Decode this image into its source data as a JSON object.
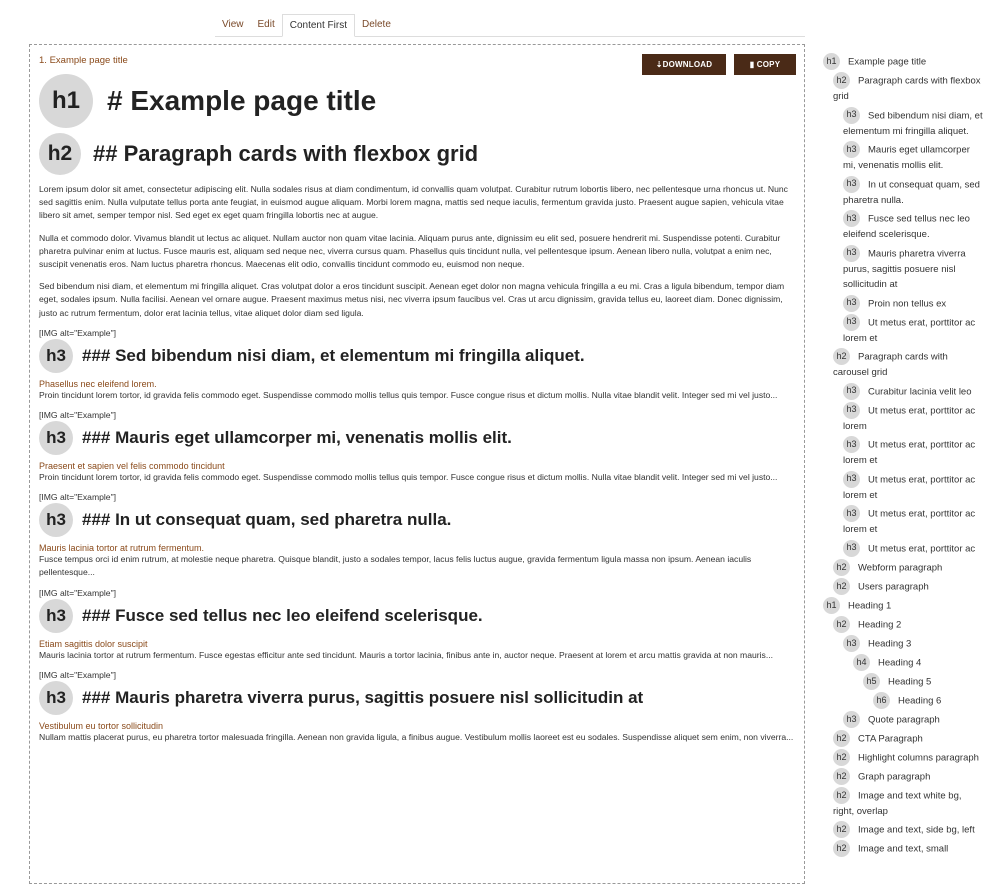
{
  "tabs": [
    "View",
    "Edit",
    "Content First",
    "Delete"
  ],
  "main": {
    "breadcrumb_num": "1.",
    "breadcrumb_text": "Example page title",
    "download_label": "⇣DOWNLOAD",
    "copy_label": "▮ COPY",
    "h1": {
      "badge": "h1",
      "text": "# Example page title"
    },
    "h2": {
      "badge": "h2",
      "text": "## Paragraph cards with flexbox grid"
    },
    "paras": [
      "Lorem ipsum dolor sit amet, consectetur adipiscing elit. Nulla sodales risus at diam condimentum, id convallis quam volutpat. Curabitur rutrum lobortis libero, nec pellentesque urna rhoncus ut. Nunc sed sagittis enim. Nulla vulputate tellus porta ante feugiat, in euismod augue aliquam. Morbi lorem magna, mattis sed neque iaculis, fermentum gravida justo. Praesent augue sapien, vehicula vitae libero sit amet, semper tempor nisl. Sed eget ex eget quam fringilla lobortis nec at augue.",
      "Nulla et commodo dolor. Vivamus blandit ut lectus ac aliquet. Nullam auctor non quam vitae lacinia. Aliquam purus ante, dignissim eu elit sed, posuere hendrerit mi. Suspendisse potenti. Curabitur pharetra pulvinar enim at luctus. Fusce mauris est, aliquam sed neque nec, viverra cursus quam. Phasellus quis tincidunt nulla, vel pellentesque ipsum. Aenean libero nulla, volutpat a enim nec, suscipit venenatis eros. Nam luctus pharetra rhoncus. Maecenas elit odio, convallis tincidunt commodo eu, euismod non neque.",
      "Sed bibendum nisi diam, et elementum mi fringilla aliquet. Cras volutpat dolor a eros tincidunt suscipit. Aenean eget dolor non magna vehicula fringilla a eu mi. Cras a ligula bibendum, tempor diam eget, sodales ipsum. Nulla facilisi. Aenean vel ornare augue. Praesent maximus metus nisi, nec viverra ipsum faucibus vel. Cras ut arcu dignissim, gravida tellus eu, laoreet diam. Donec dignissim, justo ac rutrum fermentum, dolor erat lacinia tellus, vitae aliquet dolor diam sed ligula."
    ],
    "img_label": "[IMG alt=\"Example\"]",
    "sections": [
      {
        "badge": "h3",
        "title": "### Sed bibendum nisi diam, et elementum mi fringilla aliquet.",
        "sub": "Phasellus nec eleifend lorem.",
        "text": "Proin tincidunt lorem tortor, id gravida felis commodo eget. Suspendisse commodo mollis tellus quis tempor. Fusce congue risus et dictum mollis. Nulla vitae blandit velit. Integer sed mi vel justo..."
      },
      {
        "badge": "h3",
        "title": "### Mauris eget ullamcorper mi, venenatis mollis elit.",
        "sub": "Praesent et sapien vel felis commodo tincidunt",
        "text": "Proin tincidunt lorem tortor, id gravida felis commodo eget. Suspendisse commodo mollis tellus quis tempor. Fusce congue risus et dictum mollis. Nulla vitae blandit velit. Integer sed mi vel justo..."
      },
      {
        "badge": "h3",
        "title": "### In ut consequat quam, sed pharetra nulla.",
        "sub": "Mauris lacinia tortor at rutrum fermentum.",
        "text": "Fusce tempus orci id enim rutrum, at molestie neque pharetra. Quisque blandit, justo a sodales tempor, lacus felis luctus augue, gravida fermentum ligula massa non ipsum. Aenean iaculis pellentesque..."
      },
      {
        "badge": "h3",
        "title": "### Fusce sed tellus nec leo eleifend scelerisque.",
        "sub": "Etiam sagittis dolor suscipit",
        "text": "Mauris lacinia tortor at rutrum fermentum. Fusce egestas efficitur ante sed tincidunt. Mauris a tortor lacinia, finibus ante in, auctor neque. Praesent at lorem et arcu mattis gravida at non mauris..."
      },
      {
        "badge": "h3",
        "title": "### Mauris pharetra viverra purus, sagittis posuere nisl sollicitudin at",
        "sub": "Vestibulum eu tortor sollicitudin",
        "text": "Nullam mattis placerat purus, eu pharetra tortor malesuada fringilla. Aenean non gravida ligula, a finibus augue. Vestibulum mollis laoreet est eu sodales. Suspendisse aliquet sem enim, non viverra..."
      }
    ]
  },
  "toc": [
    {
      "level": "h1",
      "text": "Example page title"
    },
    {
      "level": "h2",
      "text": "Paragraph cards with flexbox grid"
    },
    {
      "level": "h3",
      "text": "Sed bibendum nisi diam, et elementum mi fringilla aliquet."
    },
    {
      "level": "h3",
      "text": "Mauris eget ullamcorper mi, venenatis mollis elit."
    },
    {
      "level": "h3",
      "text": "In ut consequat quam, sed pharetra nulla."
    },
    {
      "level": "h3",
      "text": "Fusce sed tellus nec leo eleifend scelerisque."
    },
    {
      "level": "h3",
      "text": "Mauris pharetra viverra purus, sagittis posuere nisl sollicitudin at"
    },
    {
      "level": "h3",
      "text": "Proin non tellus ex"
    },
    {
      "level": "h3",
      "text": "Ut metus erat, porttitor ac lorem et"
    },
    {
      "level": "h2",
      "text": "Paragraph cards with carousel grid"
    },
    {
      "level": "h3",
      "text": "Curabitur lacinia velit leo"
    },
    {
      "level": "h3",
      "text": "Ut metus erat, porttitor ac lorem"
    },
    {
      "level": "h3",
      "text": "Ut metus erat, porttitor ac lorem et"
    },
    {
      "level": "h3",
      "text": "Ut metus erat, porttitor ac lorem et"
    },
    {
      "level": "h3",
      "text": "Ut metus erat, porttitor ac lorem et"
    },
    {
      "level": "h3",
      "text": "Ut metus erat, porttitor ac"
    },
    {
      "level": "h2",
      "text": "Webform paragraph"
    },
    {
      "level": "h2",
      "text": "Users paragraph"
    },
    {
      "level": "h1",
      "text": "Heading 1"
    },
    {
      "level": "h2",
      "text": "Heading 2"
    },
    {
      "level": "h3",
      "text": "Heading 3"
    },
    {
      "level": "h4",
      "text": "Heading 4"
    },
    {
      "level": "h5",
      "text": "Heading 5"
    },
    {
      "level": "h6",
      "text": "Heading 6"
    },
    {
      "level": "h3",
      "text": "Quote paragraph"
    },
    {
      "level": "h2",
      "text": "CTA Paragraph"
    },
    {
      "level": "h2",
      "text": "Highlight columns paragraph"
    },
    {
      "level": "h2",
      "text": "Graph paragraph"
    },
    {
      "level": "h2",
      "text": "Image and text white bg, right, overlap"
    },
    {
      "level": "h2",
      "text": "Image and text, side bg, left"
    },
    {
      "level": "h2",
      "text": "Image and text, small"
    }
  ]
}
